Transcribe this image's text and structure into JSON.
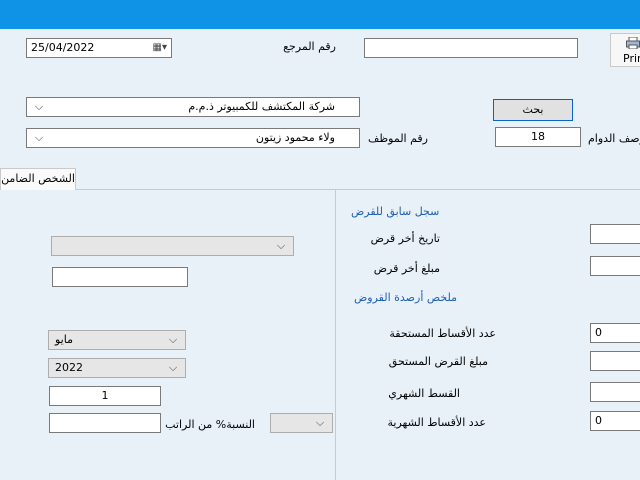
{
  "colors": {
    "titlebar": "#0e93e6",
    "background": "#e8f1f8",
    "section_title": "#1f5fb3"
  },
  "header": {
    "date_value": "25/04/2022",
    "reference_label": "رقم المرجع",
    "reference_value": "",
    "print_label": "Print"
  },
  "search": {
    "company_value": "شركة المكتشف للكمبيوتر ذ.م.م",
    "search_button": "بحث",
    "employee_name_value": "ولاء محمود زيتون",
    "employee_number_label": "رقم الموظف",
    "shift_description_label": "وصف الدوام",
    "shift_value": "18"
  },
  "tabs": {
    "guarantor_tab": "الشخص الضامن"
  },
  "previous_loan": {
    "section_title": "سجل سابق للقرض",
    "last_loan_date_label": "تاريخ أخر قرض",
    "last_loan_date_value": "",
    "last_loan_amount_label": "مبلغ أخر قرض",
    "last_loan_amount_value": ""
  },
  "balances": {
    "section_title": "ملخص أرصدة القروض",
    "due_installments_count_label": "عدد الأقساط المستحقة",
    "due_installments_count_value": "0",
    "due_loan_amount_label": "مبلغ القرض المستحق",
    "due_loan_amount_value": "",
    "monthly_installment_label": "القسط الشهري",
    "monthly_installment_value": "",
    "monthly_installments_count_label": "عدد الأقساط الشهرية",
    "monthly_installments_count_value": "0"
  },
  "left_form": {
    "dropdown1_value": "",
    "text1_value": "",
    "month_value": "مايو",
    "year_value": "2022",
    "count_value": "1",
    "salary_percent_label": "النسبة% من الراتب",
    "salary_percent_value": "",
    "percent_dropdown_value": ""
  }
}
